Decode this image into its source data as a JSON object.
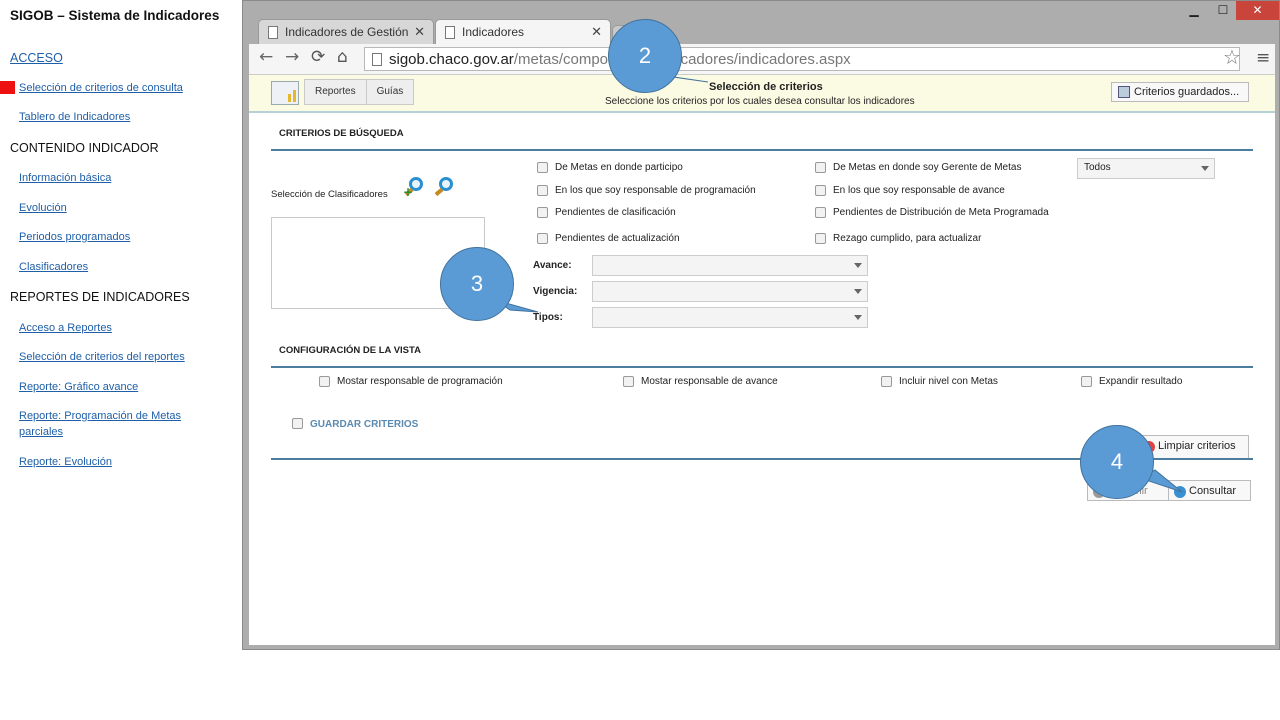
{
  "sidebar": {
    "title": "SIGOB – Sistema de Indicadores",
    "acceso": "ACCESO",
    "links_acceso": [
      "Selección de criterios de consulta",
      "Tablero de Indicadores"
    ],
    "contenido_title": "CONTENIDO INDICADOR",
    "links_contenido": [
      "Información básica",
      "Evolución",
      "Periodos programados",
      "Clasificadores"
    ],
    "reportes_title": "REPORTES DE INDICADORES",
    "links_reportes": [
      "Acceso a Reportes",
      "Selección de criterios del reportes",
      "Reporte: Gráfico avance",
      "Reporte: Programación de Metas parciales",
      "Reporte: Evolución"
    ],
    "active_marker_color": "#ee1111"
  },
  "browser": {
    "tabs": [
      "Indicadores de Gestión",
      "Indicadores"
    ],
    "tab_close": "✕",
    "url_host": "sigob.chaco.gov.ar",
    "url_path": "/metas/componentes/indicadores/indicadores.aspx",
    "window_buttons": {
      "minimize": "▁",
      "maximize": "☐",
      "close": "✕"
    },
    "nav_icons": {
      "back": "←",
      "forward": "→",
      "reload": "⟳",
      "home": "⌂",
      "star": "☆",
      "menu": "≡"
    }
  },
  "page": {
    "toolbar_buttons": [
      "Reportes",
      "Guías"
    ],
    "header_title": "Selección de criterios",
    "header_subtitle": "Seleccione los criterios por los cuales desea consultar los indicadores",
    "saved_criteria_button": "Criterios guardados...",
    "search_title": "CRITERIOS DE BÚSQUEDA",
    "clasificadores_label": "Selección de Clasificadores",
    "checks_left": [
      "De Metas en donde participo",
      "En los que soy responsable de programación",
      "Pendientes de clasificación",
      "Pendientes de actualización"
    ],
    "checks_right": [
      "De Metas en donde soy Gerente de Metas",
      "En los que soy responsable de avance",
      "Pendientes de Distribución de Meta Programada",
      "Rezago cumplido, para actualizar"
    ],
    "todos_select": "Todos",
    "field_labels": [
      "Avance:",
      "Vigencia:",
      "Tipos:"
    ],
    "view_title": "CONFIGURACIÓN DE LA VISTA",
    "view_checks": [
      "Mostar responsable de programación",
      "Mostar responsable de avance",
      "Incluir nivel con Metas",
      "Expandir resultado"
    ],
    "save_criteria": "GUARDAR CRITERIOS",
    "clear_button": "Limpiar criterios",
    "print_button": "Imprimir",
    "consult_button": "Consultar"
  },
  "callouts": [
    "2",
    "3",
    "4"
  ],
  "colors": {
    "callout": "#5b9bd5",
    "header_bg": "#fbfbe3",
    "accent_line": "#4a7d9e",
    "link": "#1f5fa8"
  }
}
